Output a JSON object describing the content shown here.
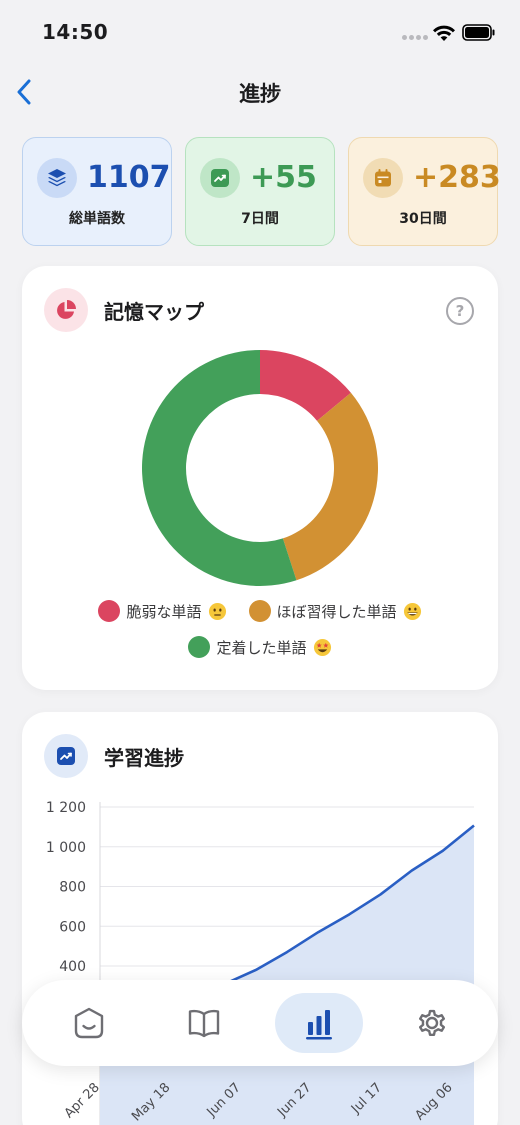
{
  "status_bar": {
    "time": "14:50"
  },
  "header": {
    "title": "進捗"
  },
  "stats": [
    {
      "value": "1107",
      "label": "総単語数",
      "icon": "layers-icon",
      "color": "#1c4fb0"
    },
    {
      "value": "+55",
      "label": "7日間",
      "icon": "trending-up-icon",
      "color": "#3d9a55"
    },
    {
      "value": "+283",
      "label": "30日間",
      "icon": "calendar-icon",
      "color": "#c98a23"
    }
  ],
  "memory_map": {
    "title": "記憶マップ",
    "icon": "pie-chart-icon",
    "legend": [
      {
        "label": "脆弱な単語",
        "color": "#db4560",
        "emoji": "neutral-face"
      },
      {
        "label": "ほぼ習得した単語",
        "color": "#d29133",
        "emoji": "grinning-face"
      },
      {
        "label": "定着した単語",
        "color": "#43a05a",
        "emoji": "star-struck"
      }
    ]
  },
  "progress": {
    "title": "学習進捗",
    "icon": "chart-up-icon"
  },
  "chart_data": [
    {
      "type": "pie",
      "title": "記憶マップ",
      "categories": [
        "脆弱な単語",
        "ほぼ習得した単語",
        "定着した単語"
      ],
      "values": [
        14,
        31,
        55
      ],
      "unit": "percent",
      "colors": [
        "#db4560",
        "#d29133",
        "#43a05a"
      ],
      "donut": true
    },
    {
      "type": "area",
      "title": "学習進捗",
      "ylim": [
        0,
        1200
      ],
      "yticks": [
        "1 200",
        "1 000",
        "800",
        "600",
        "400"
      ],
      "xticks": [
        "Apr 28",
        "May 18",
        "Jun 07",
        "Jun 27",
        "Jul 17",
        "Aug 06"
      ],
      "x": [
        "2025-04-28",
        "2025-05-18",
        "2025-06-07",
        "2025-06-17",
        "2025-06-27",
        "2025-07-07",
        "2025-07-17",
        "2025-07-27",
        "2025-08-06",
        "2025-08-16",
        "2025-08-26"
      ],
      "series": [
        {
          "values": [
            0,
            120,
            310,
            380,
            470,
            570,
            660,
            760,
            880,
            980,
            1107
          ]
        }
      ],
      "grid": true,
      "color": "#2a5fc4"
    }
  ],
  "tab_bar": {
    "tabs": [
      {
        "name": "home",
        "icon": "home-face-icon",
        "active": false
      },
      {
        "name": "words",
        "icon": "book-icon",
        "active": false
      },
      {
        "name": "progress",
        "icon": "bar-chart-icon",
        "active": true
      },
      {
        "name": "settings",
        "icon": "gear-icon",
        "active": false
      }
    ]
  }
}
